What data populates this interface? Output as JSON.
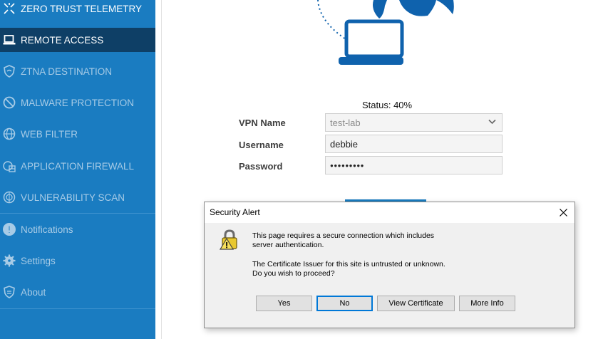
{
  "sidebar": {
    "items": [
      {
        "label": "ZERO TRUST TELEMETRY",
        "icon": "telemetry-icon"
      },
      {
        "label": "REMOTE ACCESS",
        "icon": "laptop-icon"
      },
      {
        "label": "ZTNA DESTINATION",
        "icon": "shield-icon"
      },
      {
        "label": "MALWARE PROTECTION",
        "icon": "malware-icon"
      },
      {
        "label": "WEB FILTER",
        "icon": "globe-icon"
      },
      {
        "label": "APPLICATION FIREWALL",
        "icon": "firewall-icon"
      },
      {
        "label": "VULNERABILITY SCAN",
        "icon": "scan-icon"
      },
      {
        "label": "Notifications",
        "icon": "alert-icon"
      },
      {
        "label": "Settings",
        "icon": "gear-icon"
      },
      {
        "label": "About",
        "icon": "about-icon"
      }
    ]
  },
  "vpn": {
    "status": "Status: 40%",
    "progress_percent": 40,
    "vpn_name_label": "VPN Name",
    "vpn_name_value": "test-lab",
    "username_label": "Username",
    "username_value": "debbie",
    "password_label": "Password",
    "password_value": "●●●●●●●●●"
  },
  "dialog": {
    "title": "Security Alert",
    "icon": "security-lock-warning-icon",
    "line1": "This page requires a secure connection which includes",
    "line2": "server authentication.",
    "line3": "The Certificate Issuer for this site is untrusted or unknown.",
    "line4": "Do you wish to proceed?",
    "buttons": {
      "yes": "Yes",
      "no": "No",
      "view_certificate": "View Certificate",
      "more_info": "More Info"
    }
  },
  "colors": {
    "sidebar": "#1a7cc1",
    "sidebar_active": "#0e3f66",
    "brand_blue": "#0f62ad",
    "default_button_border": "#0078d7"
  }
}
